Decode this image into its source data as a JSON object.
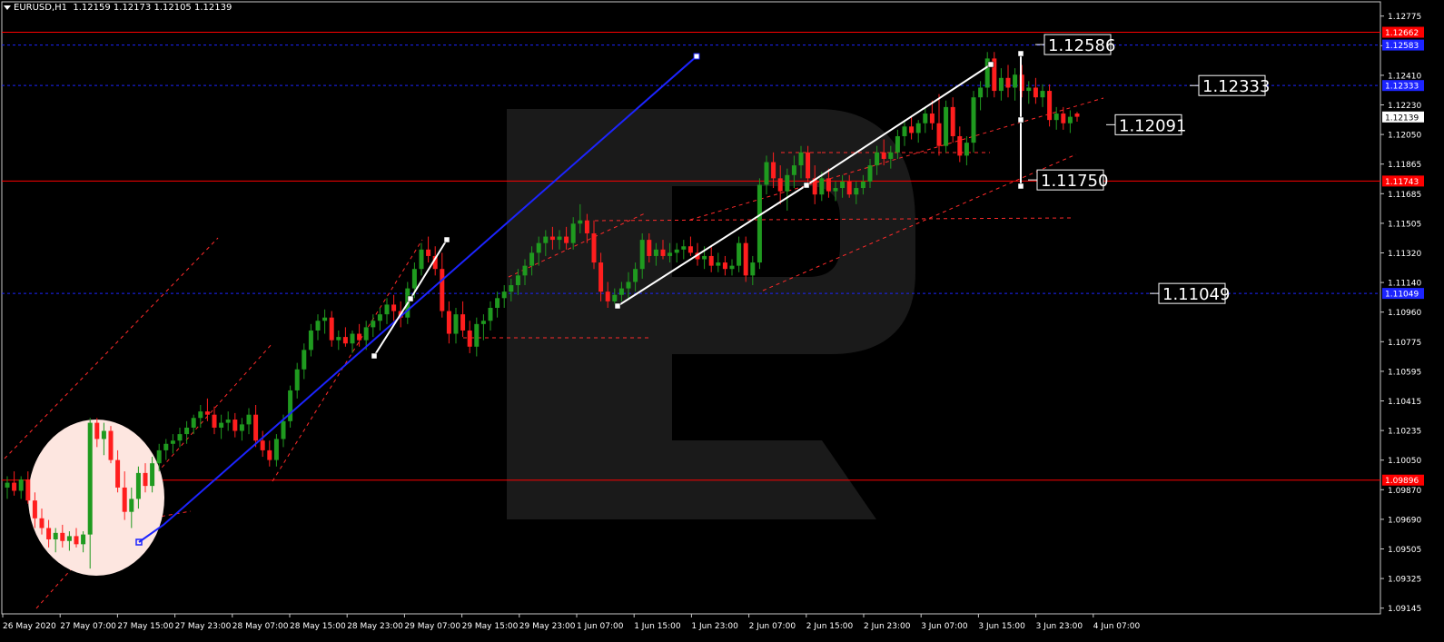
{
  "header": {
    "symbol": "EURUSD,H1",
    "ohlc": "1.12159 1.12173 1.12105 1.12139"
  },
  "colors": {
    "background": "#000000",
    "bull": "#1f9a1f",
    "bear": "#ff1e1e",
    "red_level": "#ff0000",
    "blue_level": "#1c24ff",
    "trendline": "#ffffff",
    "channel": "#ff2a2a"
  },
  "price_axis": {
    "ticks": [
      "1.12775",
      "1.12595",
      "1.12410",
      "1.12230",
      "1.12050",
      "1.11865",
      "1.11685",
      "1.11505",
      "1.11320",
      "1.11140",
      "1.10960",
      "1.10775",
      "1.10595",
      "1.10415",
      "1.10235",
      "1.10050",
      "1.09870",
      "1.09690",
      "1.09505",
      "1.09325",
      "1.09145"
    ],
    "current_price": "1.12139",
    "level_tags": [
      {
        "value": "1.12662",
        "price": 1.12662,
        "color": "#ff0000"
      },
      {
        "value": "1.12583",
        "price": 1.12583,
        "color": "#1c24ff"
      },
      {
        "value": "1.12333",
        "price": 1.12333,
        "color": "#1c24ff"
      },
      {
        "value": "1.11743",
        "price": 1.11743,
        "color": "#ff0000"
      },
      {
        "value": "1.11049",
        "price": 1.11049,
        "color": "#1c24ff"
      },
      {
        "value": "1.09896",
        "price": 1.09896,
        "color": "#ff0000"
      }
    ]
  },
  "time_axis": {
    "labels": [
      "26 May 2020",
      "27 May 07:00",
      "27 May 15:00",
      "27 May 23:00",
      "28 May 07:00",
      "28 May 15:00",
      "28 May 23:00",
      "29 May 07:00",
      "29 May 15:00",
      "29 May 23:00",
      "1 Jun 07:00",
      "1 Jun 15:00",
      "1 Jun 23:00",
      "2 Jun 07:00",
      "2 Jun 15:00",
      "2 Jun 23:00",
      "3 Jun 07:00",
      "3 Jun 15:00",
      "3 Jun 23:00",
      "4 Jun 07:00"
    ]
  },
  "annotations": [
    {
      "text": "1.12586",
      "price": 1.12586,
      "anchor": "target-high"
    },
    {
      "text": "1.12333",
      "price": 1.12333,
      "anchor": "level"
    },
    {
      "text": "1.12091",
      "price": 1.12091,
      "anchor": "target-next"
    },
    {
      "text": "1.11750",
      "price": 1.1175,
      "anchor": "target-low"
    },
    {
      "text": "1.11049",
      "price": 1.11049,
      "anchor": "level"
    }
  ],
  "chart_data": {
    "type": "candlestick",
    "title": "EURUSD,H1",
    "ylim": [
      1.0907,
      1.1285
    ],
    "x_ticks": [
      "26 May 2020",
      "27 May 07:00",
      "27 May 15:00",
      "27 May 23:00",
      "28 May 07:00",
      "28 May 15:00",
      "28 May 23:00",
      "29 May 07:00",
      "29 May 15:00",
      "29 May 23:00",
      "1 Jun 07:00",
      "1 Jun 15:00",
      "1 Jun 23:00",
      "2 Jun 07:00",
      "2 Jun 15:00",
      "2 Jun 23:00",
      "3 Jun 07:00",
      "3 Jun 15:00",
      "3 Jun 23:00",
      "4 Jun 07:00"
    ],
    "candles": [
      {
        "o": 1.0985,
        "h": 1.0992,
        "l": 1.0978,
        "c": 1.0988
      },
      {
        "o": 1.0988,
        "h": 1.0995,
        "l": 1.098,
        "c": 1.0983
      },
      {
        "o": 1.0983,
        "h": 1.0992,
        "l": 1.0978,
        "c": 1.099
      },
      {
        "o": 1.099,
        "h": 1.0995,
        "l": 1.0975,
        "c": 1.0977
      },
      {
        "o": 1.0977,
        "h": 1.0982,
        "l": 1.096,
        "c": 1.0966
      },
      {
        "o": 1.0966,
        "h": 1.0972,
        "l": 1.0956,
        "c": 1.096
      },
      {
        "o": 1.096,
        "h": 1.0965,
        "l": 1.0948,
        "c": 1.0953
      },
      {
        "o": 1.0953,
        "h": 1.096,
        "l": 1.0945,
        "c": 1.0957
      },
      {
        "o": 1.0957,
        "h": 1.0962,
        "l": 1.0948,
        "c": 1.0952
      },
      {
        "o": 1.0952,
        "h": 1.0958,
        "l": 1.0946,
        "c": 1.0955
      },
      {
        "o": 1.0955,
        "h": 1.096,
        "l": 1.0948,
        "c": 1.095
      },
      {
        "o": 1.095,
        "h": 1.0958,
        "l": 1.0945,
        "c": 1.0956
      },
      {
        "o": 1.0956,
        "h": 1.1028,
        "l": 1.0935,
        "c": 1.1025
      },
      {
        "o": 1.1025,
        "h": 1.1028,
        "l": 1.101,
        "c": 1.1015
      },
      {
        "o": 1.1015,
        "h": 1.1025,
        "l": 1.1005,
        "c": 1.102
      },
      {
        "o": 1.102,
        "h": 1.1023,
        "l": 1.1,
        "c": 1.1002
      },
      {
        "o": 1.1002,
        "h": 1.1008,
        "l": 1.0982,
        "c": 1.0985
      },
      {
        "o": 1.0985,
        "h": 1.0995,
        "l": 1.0965,
        "c": 1.097
      },
      {
        "o": 1.097,
        "h": 1.0985,
        "l": 1.096,
        "c": 1.0978
      },
      {
        "o": 1.0978,
        "h": 1.0998,
        "l": 1.0972,
        "c": 1.0994
      },
      {
        "o": 1.0994,
        "h": 1.1,
        "l": 1.0982,
        "c": 1.0986
      },
      {
        "o": 1.0986,
        "h": 1.1004,
        "l": 1.0982,
        "c": 1.1
      },
      {
        "o": 1.1,
        "h": 1.1012,
        "l": 1.0995,
        "c": 1.1008
      },
      {
        "o": 1.1008,
        "h": 1.1015,
        "l": 1.1002,
        "c": 1.1012
      },
      {
        "o": 1.1012,
        "h": 1.1018,
        "l": 1.1006,
        "c": 1.1014
      },
      {
        "o": 1.1014,
        "h": 1.1022,
        "l": 1.101,
        "c": 1.1018
      },
      {
        "o": 1.1018,
        "h": 1.1026,
        "l": 1.1012,
        "c": 1.1022
      },
      {
        "o": 1.1022,
        "h": 1.103,
        "l": 1.1018,
        "c": 1.1028
      },
      {
        "o": 1.1028,
        "h": 1.1036,
        "l": 1.1022,
        "c": 1.1032
      },
      {
        "o": 1.1032,
        "h": 1.104,
        "l": 1.1026,
        "c": 1.103
      },
      {
        "o": 1.103,
        "h": 1.1035,
        "l": 1.1018,
        "c": 1.1022
      },
      {
        "o": 1.1022,
        "h": 1.103,
        "l": 1.1015,
        "c": 1.1025
      },
      {
        "o": 1.1025,
        "h": 1.1032,
        "l": 1.102,
        "c": 1.1027
      },
      {
        "o": 1.1027,
        "h": 1.1031,
        "l": 1.1016,
        "c": 1.102
      },
      {
        "o": 1.102,
        "h": 1.1028,
        "l": 1.1014,
        "c": 1.1024
      },
      {
        "o": 1.1024,
        "h": 1.1034,
        "l": 1.1018,
        "c": 1.103
      },
      {
        "o": 1.103,
        "h": 1.1036,
        "l": 1.101,
        "c": 1.1014
      },
      {
        "o": 1.1014,
        "h": 1.102,
        "l": 1.1004,
        "c": 1.1008
      },
      {
        "o": 1.1008,
        "h": 1.1014,
        "l": 1.0998,
        "c": 1.1002
      },
      {
        "o": 1.1002,
        "h": 1.1018,
        "l": 1.0998,
        "c": 1.1015
      },
      {
        "o": 1.1015,
        "h": 1.103,
        "l": 1.101,
        "c": 1.1026
      },
      {
        "o": 1.1026,
        "h": 1.1048,
        "l": 1.1022,
        "c": 1.1045
      },
      {
        "o": 1.1045,
        "h": 1.1062,
        "l": 1.104,
        "c": 1.1058
      },
      {
        "o": 1.1058,
        "h": 1.1074,
        "l": 1.1052,
        "c": 1.107
      },
      {
        "o": 1.107,
        "h": 1.1086,
        "l": 1.1066,
        "c": 1.1082
      },
      {
        "o": 1.1082,
        "h": 1.1092,
        "l": 1.1076,
        "c": 1.1088
      },
      {
        "o": 1.1088,
        "h": 1.1095,
        "l": 1.108,
        "c": 1.109
      },
      {
        "o": 1.109,
        "h": 1.1094,
        "l": 1.1072,
        "c": 1.1076
      },
      {
        "o": 1.1076,
        "h": 1.1082,
        "l": 1.107,
        "c": 1.1078
      },
      {
        "o": 1.1078,
        "h": 1.1084,
        "l": 1.1072,
        "c": 1.1074
      },
      {
        "o": 1.1074,
        "h": 1.1082,
        "l": 1.1068,
        "c": 1.108
      },
      {
        "o": 1.108,
        "h": 1.1086,
        "l": 1.1072,
        "c": 1.1076
      },
      {
        "o": 1.1076,
        "h": 1.1088,
        "l": 1.107,
        "c": 1.1084
      },
      {
        "o": 1.1084,
        "h": 1.1092,
        "l": 1.1078,
        "c": 1.1088
      },
      {
        "o": 1.1088,
        "h": 1.1096,
        "l": 1.1082,
        "c": 1.1092
      },
      {
        "o": 1.1092,
        "h": 1.1102,
        "l": 1.1086,
        "c": 1.1098
      },
      {
        "o": 1.1098,
        "h": 1.1104,
        "l": 1.1088,
        "c": 1.1094
      },
      {
        "o": 1.1094,
        "h": 1.11,
        "l": 1.1084,
        "c": 1.109
      },
      {
        "o": 1.109,
        "h": 1.1112,
        "l": 1.1086,
        "c": 1.1108
      },
      {
        "o": 1.1108,
        "h": 1.1124,
        "l": 1.1102,
        "c": 1.112
      },
      {
        "o": 1.112,
        "h": 1.1136,
        "l": 1.1116,
        "c": 1.1132
      },
      {
        "o": 1.1132,
        "h": 1.114,
        "l": 1.1124,
        "c": 1.1128
      },
      {
        "o": 1.1128,
        "h": 1.1134,
        "l": 1.1116,
        "c": 1.112
      },
      {
        "o": 1.112,
        "h": 1.113,
        "l": 1.109,
        "c": 1.1094
      },
      {
        "o": 1.1094,
        "h": 1.11,
        "l": 1.1074,
        "c": 1.108
      },
      {
        "o": 1.108,
        "h": 1.1096,
        "l": 1.1074,
        "c": 1.1092
      },
      {
        "o": 1.1092,
        "h": 1.11,
        "l": 1.1078,
        "c": 1.1082
      },
      {
        "o": 1.1082,
        "h": 1.1088,
        "l": 1.1068,
        "c": 1.1072
      },
      {
        "o": 1.1072,
        "h": 1.109,
        "l": 1.1066,
        "c": 1.1086
      },
      {
        "o": 1.1086,
        "h": 1.1092,
        "l": 1.1076,
        "c": 1.1088
      },
      {
        "o": 1.1088,
        "h": 1.11,
        "l": 1.1082,
        "c": 1.1096
      },
      {
        "o": 1.1096,
        "h": 1.1106,
        "l": 1.109,
        "c": 1.1102
      },
      {
        "o": 1.1102,
        "h": 1.111,
        "l": 1.1096,
        "c": 1.1106
      },
      {
        "o": 1.1106,
        "h": 1.1114,
        "l": 1.11,
        "c": 1.111
      },
      {
        "o": 1.111,
        "h": 1.112,
        "l": 1.1104,
        "c": 1.1116
      },
      {
        "o": 1.1116,
        "h": 1.1126,
        "l": 1.111,
        "c": 1.1122
      },
      {
        "o": 1.1122,
        "h": 1.1134,
        "l": 1.1116,
        "c": 1.113
      },
      {
        "o": 1.113,
        "h": 1.114,
        "l": 1.1122,
        "c": 1.1136
      },
      {
        "o": 1.1136,
        "h": 1.1144,
        "l": 1.1128,
        "c": 1.114
      },
      {
        "o": 1.114,
        "h": 1.1146,
        "l": 1.1132,
        "c": 1.1138
      },
      {
        "o": 1.1138,
        "h": 1.1144,
        "l": 1.1132,
        "c": 1.114
      },
      {
        "o": 1.114,
        "h": 1.1146,
        "l": 1.1132,
        "c": 1.1136
      },
      {
        "o": 1.1136,
        "h": 1.1152,
        "l": 1.1132,
        "c": 1.1148
      },
      {
        "o": 1.1148,
        "h": 1.116,
        "l": 1.1142,
        "c": 1.115
      },
      {
        "o": 1.115,
        "h": 1.1154,
        "l": 1.1136,
        "c": 1.1142
      },
      {
        "o": 1.1142,
        "h": 1.115,
        "l": 1.112,
        "c": 1.1124
      },
      {
        "o": 1.1124,
        "h": 1.113,
        "l": 1.11,
        "c": 1.1106
      },
      {
        "o": 1.1106,
        "h": 1.1112,
        "l": 1.1096,
        "c": 1.11
      },
      {
        "o": 1.11,
        "h": 1.1108,
        "l": 1.1098,
        "c": 1.1104
      },
      {
        "o": 1.1104,
        "h": 1.1112,
        "l": 1.11,
        "c": 1.1108
      },
      {
        "o": 1.1108,
        "h": 1.1118,
        "l": 1.1102,
        "c": 1.1112
      },
      {
        "o": 1.1112,
        "h": 1.1124,
        "l": 1.1106,
        "c": 1.112
      },
      {
        "o": 1.112,
        "h": 1.1142,
        "l": 1.1114,
        "c": 1.1138
      },
      {
        "o": 1.1138,
        "h": 1.1142,
        "l": 1.1124,
        "c": 1.1128
      },
      {
        "o": 1.1128,
        "h": 1.1136,
        "l": 1.1122,
        "c": 1.1132
      },
      {
        "o": 1.1132,
        "h": 1.1138,
        "l": 1.1126,
        "c": 1.1128
      },
      {
        "o": 1.1128,
        "h": 1.1136,
        "l": 1.1124,
        "c": 1.113
      },
      {
        "o": 1.113,
        "h": 1.1136,
        "l": 1.1124,
        "c": 1.1132
      },
      {
        "o": 1.1132,
        "h": 1.1138,
        "l": 1.1126,
        "c": 1.1134
      },
      {
        "o": 1.1134,
        "h": 1.114,
        "l": 1.1128,
        "c": 1.113
      },
      {
        "o": 1.113,
        "h": 1.1136,
        "l": 1.1122,
        "c": 1.1126
      },
      {
        "o": 1.1126,
        "h": 1.1134,
        "l": 1.112,
        "c": 1.1128
      },
      {
        "o": 1.1128,
        "h": 1.1134,
        "l": 1.1118,
        "c": 1.1122
      },
      {
        "o": 1.1122,
        "h": 1.113,
        "l": 1.1118,
        "c": 1.1124
      },
      {
        "o": 1.1124,
        "h": 1.1128,
        "l": 1.1116,
        "c": 1.112
      },
      {
        "o": 1.112,
        "h": 1.1126,
        "l": 1.1116,
        "c": 1.1122
      },
      {
        "o": 1.1122,
        "h": 1.114,
        "l": 1.1118,
        "c": 1.1136
      },
      {
        "o": 1.1136,
        "h": 1.114,
        "l": 1.1112,
        "c": 1.1116
      },
      {
        "o": 1.1116,
        "h": 1.1128,
        "l": 1.111,
        "c": 1.1124
      },
      {
        "o": 1.1124,
        "h": 1.1176,
        "l": 1.112,
        "c": 1.1172
      },
      {
        "o": 1.1172,
        "h": 1.119,
        "l": 1.1166,
        "c": 1.1186
      },
      {
        "o": 1.1186,
        "h": 1.1192,
        "l": 1.117,
        "c": 1.1176
      },
      {
        "o": 1.1176,
        "h": 1.1184,
        "l": 1.116,
        "c": 1.1168
      },
      {
        "o": 1.1168,
        "h": 1.1182,
        "l": 1.1156,
        "c": 1.1178
      },
      {
        "o": 1.1178,
        "h": 1.119,
        "l": 1.117,
        "c": 1.1184
      },
      {
        "o": 1.1184,
        "h": 1.1196,
        "l": 1.1176,
        "c": 1.1192
      },
      {
        "o": 1.1192,
        "h": 1.1196,
        "l": 1.1172,
        "c": 1.1176
      },
      {
        "o": 1.1176,
        "h": 1.1184,
        "l": 1.116,
        "c": 1.1166
      },
      {
        "o": 1.1166,
        "h": 1.118,
        "l": 1.1162,
        "c": 1.1176
      },
      {
        "o": 1.1176,
        "h": 1.1182,
        "l": 1.1164,
        "c": 1.1168
      },
      {
        "o": 1.1168,
        "h": 1.1174,
        "l": 1.1162,
        "c": 1.117
      },
      {
        "o": 1.117,
        "h": 1.1178,
        "l": 1.1164,
        "c": 1.1174
      },
      {
        "o": 1.1174,
        "h": 1.1178,
        "l": 1.1164,
        "c": 1.1166
      },
      {
        "o": 1.1166,
        "h": 1.1174,
        "l": 1.116,
        "c": 1.117
      },
      {
        "o": 1.117,
        "h": 1.1178,
        "l": 1.1166,
        "c": 1.1174
      },
      {
        "o": 1.1174,
        "h": 1.1188,
        "l": 1.117,
        "c": 1.1184
      },
      {
        "o": 1.1184,
        "h": 1.1196,
        "l": 1.1178,
        "c": 1.1192
      },
      {
        "o": 1.1192,
        "h": 1.12,
        "l": 1.1184,
        "c": 1.1188
      },
      {
        "o": 1.1188,
        "h": 1.1196,
        "l": 1.1182,
        "c": 1.1192
      },
      {
        "o": 1.1192,
        "h": 1.1206,
        "l": 1.1188,
        "c": 1.1202
      },
      {
        "o": 1.1202,
        "h": 1.1212,
        "l": 1.1196,
        "c": 1.1208
      },
      {
        "o": 1.1208,
        "h": 1.1214,
        "l": 1.12,
        "c": 1.1204
      },
      {
        "o": 1.1204,
        "h": 1.1212,
        "l": 1.1198,
        "c": 1.121
      },
      {
        "o": 1.121,
        "h": 1.122,
        "l": 1.1204,
        "c": 1.1216
      },
      {
        "o": 1.1216,
        "h": 1.1224,
        "l": 1.1206,
        "c": 1.121
      },
      {
        "o": 1.121,
        "h": 1.1228,
        "l": 1.119,
        "c": 1.1196
      },
      {
        "o": 1.1196,
        "h": 1.1224,
        "l": 1.1192,
        "c": 1.122
      },
      {
        "o": 1.122,
        "h": 1.1226,
        "l": 1.1198,
        "c": 1.1202
      },
      {
        "o": 1.1202,
        "h": 1.1208,
        "l": 1.1186,
        "c": 1.119
      },
      {
        "o": 1.119,
        "h": 1.1202,
        "l": 1.1184,
        "c": 1.1198
      },
      {
        "o": 1.1198,
        "h": 1.123,
        "l": 1.1192,
        "c": 1.1226
      },
      {
        "o": 1.1226,
        "h": 1.1236,
        "l": 1.1218,
        "c": 1.1232
      },
      {
        "o": 1.1232,
        "h": 1.1254,
        "l": 1.1226,
        "c": 1.125
      },
      {
        "o": 1.125,
        "h": 1.1254,
        "l": 1.1226,
        "c": 1.123
      },
      {
        "o": 1.123,
        "h": 1.1244,
        "l": 1.1224,
        "c": 1.1238
      },
      {
        "o": 1.1238,
        "h": 1.1246,
        "l": 1.1226,
        "c": 1.1232
      },
      {
        "o": 1.1232,
        "h": 1.1244,
        "l": 1.1224,
        "c": 1.124
      },
      {
        "o": 1.124,
        "h": 1.1246,
        "l": 1.1226,
        "c": 1.123
      },
      {
        "o": 1.123,
        "h": 1.1236,
        "l": 1.1222,
        "c": 1.1232
      },
      {
        "o": 1.1232,
        "h": 1.1238,
        "l": 1.1222,
        "c": 1.1226
      },
      {
        "o": 1.1226,
        "h": 1.1234,
        "l": 1.122,
        "c": 1.123
      },
      {
        "o": 1.123,
        "h": 1.1234,
        "l": 1.1208,
        "c": 1.1212
      },
      {
        "o": 1.1212,
        "h": 1.122,
        "l": 1.1206,
        "c": 1.1216
      },
      {
        "o": 1.1216,
        "h": 1.122,
        "l": 1.1206,
        "c": 1.121
      },
      {
        "o": 1.121,
        "h": 1.1218,
        "l": 1.1204,
        "c": 1.1214
      },
      {
        "o": 1.1216,
        "h": 1.1217,
        "l": 1.1211,
        "c": 1.1214
      }
    ]
  }
}
